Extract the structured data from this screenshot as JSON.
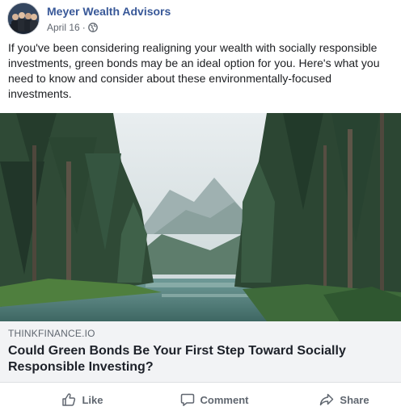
{
  "post": {
    "author": "Meyer Wealth Advisors",
    "date": "April 16",
    "separator": "·",
    "privacy_icon": "globe-icon",
    "text": "If you've been considering realigning your wealth with socially responsible investments, green bonds may be an ideal option for you. Here's what you need to know and consider about these environmentally-focused investments."
  },
  "link_card": {
    "image": "forest-lake-mountain-photo",
    "domain": "THINKFINANCE.IO",
    "title": "Could Green Bonds Be Your First Step Toward Socially Responsible Investing?"
  },
  "actions": {
    "like_label": "Like",
    "comment_label": "Comment",
    "share_label": "Share"
  },
  "colors": {
    "author_link": "#385898",
    "meta_text": "#616770",
    "card_background": "#f2f3f5",
    "action_text": "#606770"
  }
}
